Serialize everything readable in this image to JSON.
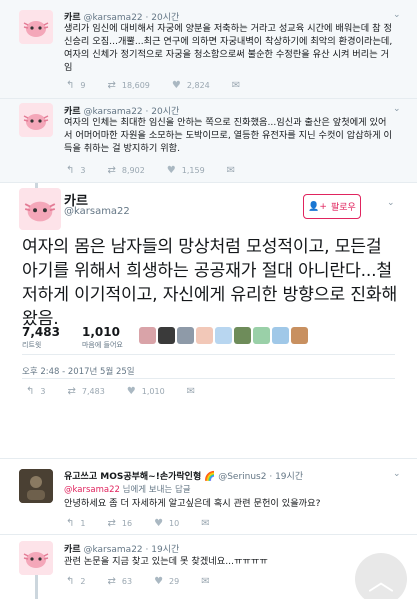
{
  "tweets_above": [
    {
      "name": "카르",
      "handle": "@karsama22",
      "time": "· 20시간",
      "text": "생리가 임신에 대비해서 자궁에 양분을 저축하는 거라고 성교육 시간에 배워는데 참 정신승리 오짐...개뿔...최근 연구에 의하면 자궁내벽이 착상하기에 최악의 환경이라는데, 여자의 신체가 정기적으로 자궁을 청소함으로써 불순한 수정란을 유산 시켜 버리는 거임",
      "replies": "9",
      "retweets": "18,609",
      "likes": "2,824"
    },
    {
      "name": "카르",
      "handle": "@karsama22",
      "time": "· 20시간",
      "text": "여자의 인체는 최대한 임신을 안하는 쪽으로 진화했음...임신과 출산은 앞첫에게 있어서 어머어마한 자원을 소모하는 도박이므로, 열등한 유전자를 지닌 수컷이 압삽하게 이득을 취하는 걸 방지하기 위함.",
      "replies": "3",
      "retweets": "8,902",
      "likes": "1,159"
    }
  ],
  "main_tweet": {
    "name": "카르",
    "handle": "@karsama22",
    "follow_label": "팔로우",
    "text": "여자의 몸은 남자들의 망상처럼 모성적이고, 모든걸 아기를 위해서 희생하는 공공재가 절대 아니란다...철저하게 이기적이고, 자신에게 유리한 방향으로 진화해 왔음.",
    "retweet_count": "7,483",
    "retweet_label": "리트윗",
    "like_count": "1,010",
    "like_label": "마음에 들어요",
    "date": "오후 2:48 - 2017년 5월 25일",
    "replies": "3",
    "retweets": "7,483",
    "likes": "1,010",
    "liker_colors": [
      "#d9a3a8",
      "#3a3a3a",
      "#8e9aa8",
      "#f2c8b8",
      "#b8d6f0",
      "#6e8c5a",
      "#9ad0a8",
      "#a0c8e8",
      "#c89060"
    ]
  },
  "replies": [
    {
      "name": "유고쓰고 MOS공부해~!손가락인형",
      "handle": "@Serinus2",
      "time": "· 19시간",
      "reply_to_handle": "@karsama22",
      "reply_to_suffix": " 님에게 보내는 답글",
      "text": "안녕하세요 좀 더 자세하게 알고싶은데 혹시 관련 문헌이 있을까요?",
      "replies": "1",
      "retweets": "16",
      "likes": "10"
    },
    {
      "name": "카르",
      "handle": "@karsama22",
      "time": "· 19시간",
      "text": "관련 논문을 지금 찾고 있는데 못 찾겠네요...ㅠㅠㅠㅠ",
      "replies": "2",
      "retweets": "63",
      "likes": "29"
    }
  ],
  "icons": {
    "reply": "reply-icon",
    "retweet": "retweet-icon",
    "like": "heart-icon",
    "dm": "dm-icon",
    "follow": "follow-user-icon",
    "scroll": "chevron-up-icon"
  },
  "colors": {
    "accent": "#e0245e",
    "muted": "#657786"
  }
}
